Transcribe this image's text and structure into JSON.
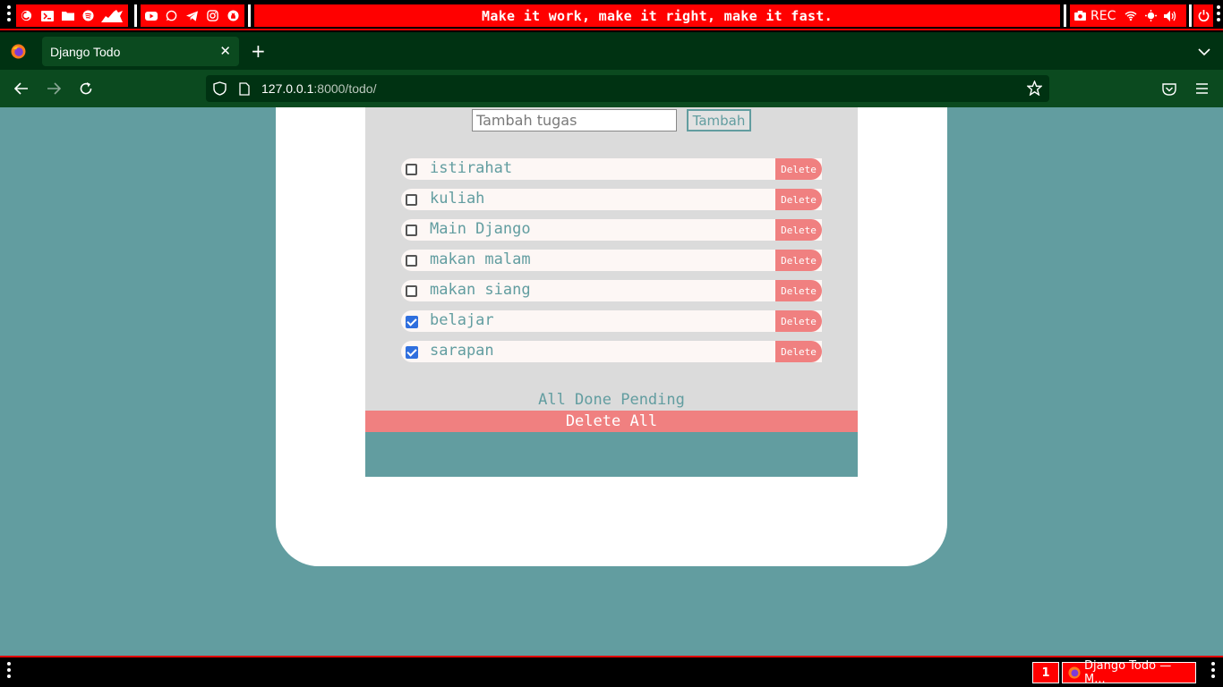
{
  "topbar": {
    "launcher_icons": [
      "debian-icon",
      "terminal-icon",
      "folder-icon",
      "spotify-icon",
      "cat-icon"
    ],
    "social_icons": [
      "youtube-icon",
      "whatsapp-icon",
      "telegram-icon",
      "instagram-icon",
      "github-icon"
    ],
    "motto": "Make it work, make it right, make it fast.",
    "status": {
      "rec_label": "REC"
    },
    "status_icons": [
      "camera-icon",
      "wifi-icon",
      "brightness-icon",
      "volume-icon"
    ],
    "power_icon": "power-icon"
  },
  "browser": {
    "tab_title": "Django Todo",
    "new_tab": "+",
    "close": "✕",
    "url_host": "127.0.0.1",
    "url_rest": ":8000/todo/"
  },
  "app": {
    "input_placeholder": "Tambah tugas",
    "add_label": "Tambah",
    "tasks": [
      {
        "label": "istirahat",
        "done": false,
        "delete_label": "Delete"
      },
      {
        "label": "kuliah",
        "done": false,
        "delete_label": "Delete"
      },
      {
        "label": "Main Django",
        "done": false,
        "delete_label": "Delete"
      },
      {
        "label": "makan malam",
        "done": false,
        "delete_label": "Delete"
      },
      {
        "label": "makan siang",
        "done": false,
        "delete_label": "Delete"
      },
      {
        "label": "belajar",
        "done": true,
        "delete_label": "Delete"
      },
      {
        "label": "sarapan",
        "done": true,
        "delete_label": "Delete"
      }
    ],
    "filters": "All Done Pending",
    "delete_all_label": "Delete All"
  },
  "bottombar": {
    "workspace": "1",
    "task_title": "Django Todo — M..."
  },
  "colors": {
    "accent": "#ff0000",
    "page_bg": "#629da0",
    "delete": "#f08080",
    "browser_dark": "#003212",
    "browser_mid": "#0b4a1f"
  }
}
